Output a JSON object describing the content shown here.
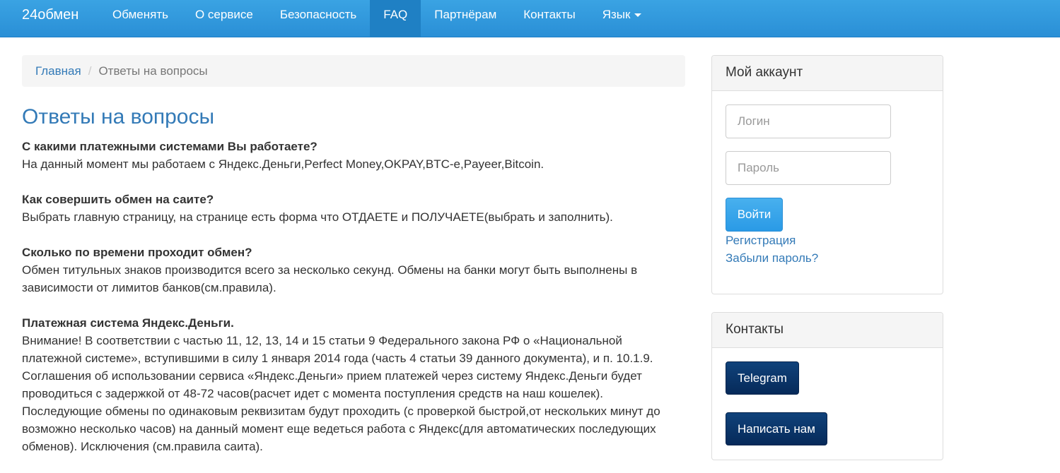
{
  "navbar": {
    "brand": "24обмен",
    "items": [
      {
        "label": "Обменять"
      },
      {
        "label": "О сервисе"
      },
      {
        "label": "Безопасность"
      },
      {
        "label": "FAQ"
      },
      {
        "label": "Партнёрам"
      },
      {
        "label": "Контакты"
      },
      {
        "label": "Язык"
      }
    ],
    "active_item": "FAQ",
    "colors": {
      "bar": "#2a8fd6",
      "active": "#1f80c4"
    }
  },
  "breadcrumb": {
    "home": "Главная",
    "separator": "/",
    "current": "Ответы на вопросы"
  },
  "main": {
    "title": "Ответы на вопросы",
    "faq": [
      {
        "question": "С какими платежными системами Вы работаете?",
        "answer": "На данный момент мы работаем с Яндекс.Деньги,Perfect Money,OKPAY,BTC-e,Payeer,Bitcoin."
      },
      {
        "question": "Как совершить обмен на саите?",
        "answer": "Выбрать главную страницу, на странице есть форма что ОТДАЕТЕ и ПОЛУЧАЕТЕ(выбрать и заполнить)."
      },
      {
        "question": "Сколько по времени проходит обмен?",
        "answer": "Обмен титульных знаков производится всего за несколько секунд. Обмены на банки могут быть выполнены в зависимости от лимитов банков(см.правила)."
      },
      {
        "question": "Платежная система Яндекс.Деньги.",
        "answer": "Внимание! В соответствии с частью 11, 12, 13, 14 и 15 статьи 9 Федерального закона РФ о «Национальной платежной системе», вступившими в силу 1 января 2014 года (часть 4 статьи 39 данного документа), и п. 10.1.9. Соглашения об использовании сервиса «Яндекс.Деньги» прием платежей через систему Яндекс.Деньги будет проводиться с задержкой от 48-72 часов(расчет идет с момента поступления средств на наш кошелек). Последующие обмены по одинаковым реквизитам будут проходить (с проверкой быстрой,от нескольких минут до возможно несколько часов) на данный момент еще ведеться работа с Яндекс(для автоматических последующих обменов). Исключения (см.правила саита)."
      }
    ]
  },
  "account": {
    "heading": "Мой аккаунт",
    "login_placeholder": "Логин",
    "password_placeholder": "Пароль",
    "login_value": "",
    "password_value": "",
    "submit_label": "Войти",
    "register_link": "Регистрация",
    "forgot_link": "Забыли пароль?"
  },
  "contacts": {
    "heading": "Контакты",
    "telegram_label": "Telegram",
    "write_label": "Написать нам"
  },
  "colors": {
    "link": "#337ab7",
    "button_primary": "#2a9ae6",
    "button_dark": "#0a3266"
  }
}
